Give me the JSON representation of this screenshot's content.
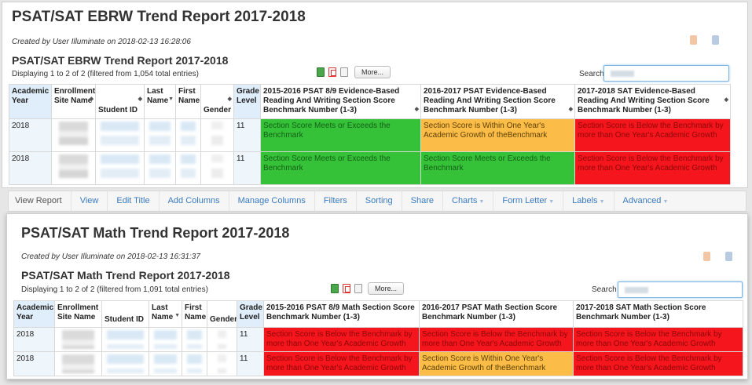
{
  "report1": {
    "big_title": "PSAT/SAT EBRW Trend Report 2017-2018",
    "created": "Created by User Illuminate on 2018-02-13 16:28:06",
    "title": "PSAT/SAT EBRW Trend Report 2017-2018",
    "displaying": "Displaying 1 to 2 of 2 (filtered from 1,054 total entries)",
    "more_label": "More...",
    "search_label": "Search",
    "columns": {
      "academic_year": "Academic Year",
      "enrollment_site": "Enrollment Site Name",
      "student_id": "Student ID",
      "last_name": "Last Name",
      "first_name": "First Name",
      "gender": "Gender",
      "grade_level": "Grade Level",
      "score1": "2015-2016 PSAT 8/9 Evidence-Based Reading And Writing Section Score Benchmark Number (1-3)",
      "score2": "2016-2017 PSAT Evidence-Based Reading And Writing Section Score Benchmark Number (1-3)",
      "score3": "2017-2018 SAT Evidence-Based Reading And Writing Section Score Benchmark Number (1-3)"
    },
    "rows": [
      {
        "year": "2018",
        "grade": "11",
        "s1": "Section Score Meets or Exceeds the Benchmark",
        "s2": "Section Score is Within One Year's Academic Growth of theBenchmark",
        "s3": "Section Score is Below the Benchmark by more than One Year's Academic Growth"
      },
      {
        "year": "2018",
        "grade": "11",
        "s1": "Section Score Meets or Exceeds the Benchmark",
        "s2": "Section Score Meets or Exceeds the Benchmark",
        "s3": "Section Score is Below the Benchmark by more than One Year's Academic Growth"
      }
    ]
  },
  "navbar": {
    "view_report": "View Report",
    "view": "View",
    "edit_title": "Edit Title",
    "add_columns": "Add Columns",
    "manage_columns": "Manage Columns",
    "filters": "Filters",
    "sorting": "Sorting",
    "share": "Share",
    "charts": "Charts",
    "form_letter": "Form Letter",
    "labels": "Labels",
    "advanced": "Advanced"
  },
  "report2": {
    "big_title": "PSAT/SAT Math Trend Report 2017-2018",
    "created": "Created by User Illuminate on 2018-02-13 16:31:37",
    "title": "PSAT/SAT Math Trend Report 2017-2018",
    "displaying": "Displaying 1 to 2 of 2 (filtered from 1,091 total entries)",
    "more_label": "More...",
    "search_label": "Search",
    "columns": {
      "academic_year": "Academic Year",
      "enrollment_site": "Enrollment Site Name",
      "student_id": "Student ID",
      "last_name": "Last Name",
      "first_name": "First Name",
      "gender": "Gender",
      "grade_level": "Grade Level",
      "score1": "2015-2016 PSAT 8/9 Math Section Score Benchmark Number (1-3)",
      "score2": "2016-2017 PSAT Math Section Score Benchmark Number (1-3)",
      "score3": "2017-2018 SAT Math Section Score Benchmark Number (1-3)"
    },
    "rows": [
      {
        "year": "2018",
        "grade": "11",
        "s1": "Section Score is Below the Benchmark by more than One Year's Academic Growth",
        "s2": "Section Score is Below the Benchmark by more than One Year's Academic Growth",
        "s3": "Section Score is Below the Benchmark by more than One Year's Academic Growth"
      },
      {
        "year": "2018",
        "grade": "11",
        "s1": "Section Score is Below the Benchmark by more than One Year's Academic Growth",
        "s2": "Section Score is Within One Year's Academic Growth of theBenchmark",
        "s3": "Section Score is Below the Benchmark by more than One Year's Academic Growth"
      }
    ]
  },
  "colors": {
    "meets": "#35c238",
    "within": "#fbbd47",
    "below": "#f4161c",
    "link": "#3a7bbf"
  },
  "icons": [
    "excel-export-icon",
    "pdf-export-icon",
    "document-export-icon",
    "orange-badge-icon",
    "blue-badge-icon"
  ]
}
